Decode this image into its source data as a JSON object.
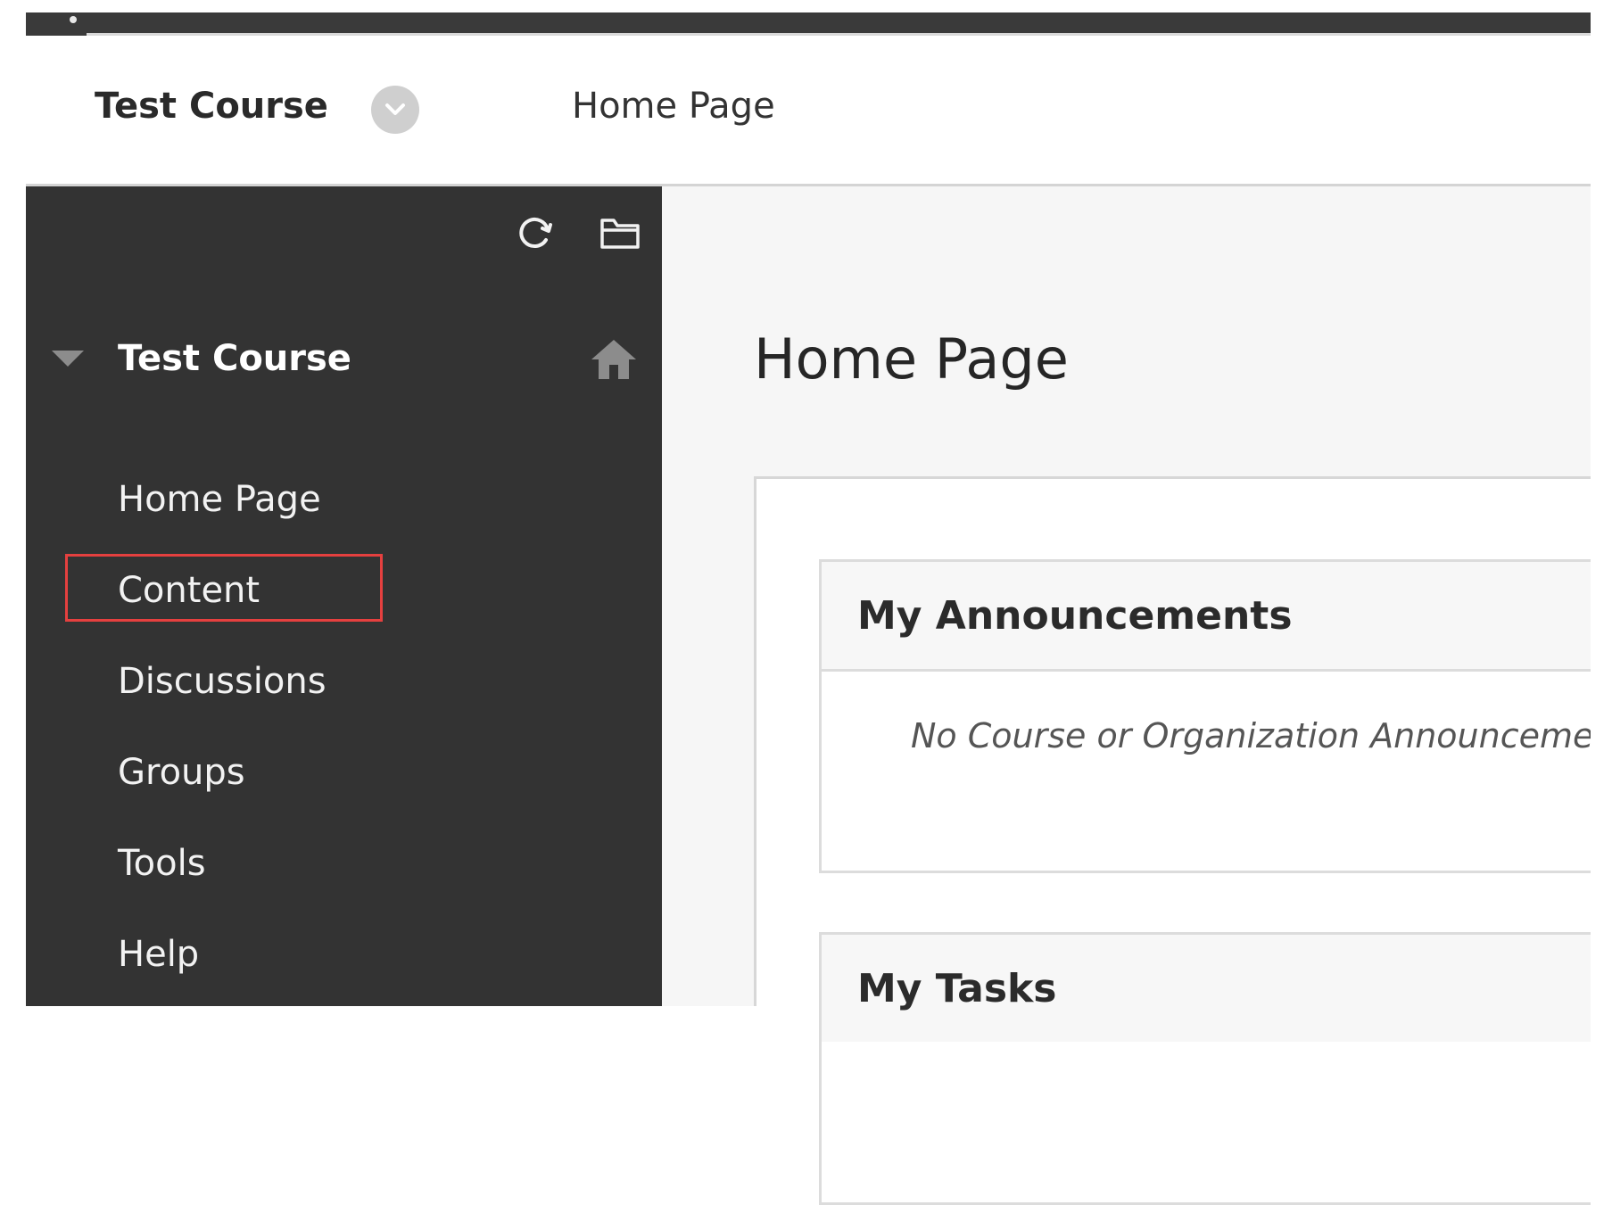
{
  "header": {
    "course_title": "Test Course",
    "breadcrumb": "Home Page"
  },
  "sidebar": {
    "course_title": "Test Course",
    "items": [
      {
        "label": "Home Page"
      },
      {
        "label": "Content"
      },
      {
        "label": "Discussions"
      },
      {
        "label": "Groups"
      },
      {
        "label": "Tools"
      },
      {
        "label": "Help"
      }
    ],
    "icons": [
      "refresh-icon",
      "folder-icon",
      "collapse-arrow-icon",
      "home-icon"
    ]
  },
  "main": {
    "page_title": "Home Page",
    "modules": [
      {
        "title": "My Announcements",
        "body": "No Course or Organization Announcements"
      },
      {
        "title": "My Tasks"
      }
    ]
  },
  "colors": {
    "sidebar_bg": "#333333",
    "highlight_border": "#e5403f",
    "main_bg": "#f6f6f6"
  }
}
